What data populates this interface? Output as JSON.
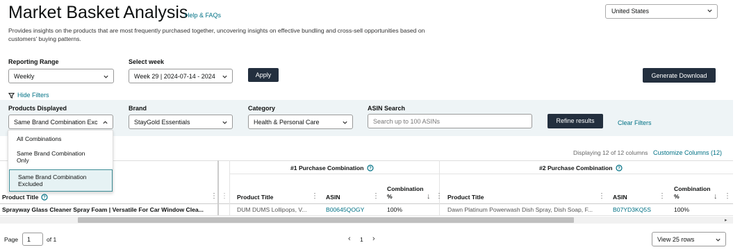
{
  "header": {
    "title": "Market Basket Analysis",
    "help_link": "Help & FAQs",
    "description": "Provides insights on the products that are most frequently purchased together, uncovering insights on effective bundling and cross-sell opportunities based on customers' buying patterns.",
    "country": "United States"
  },
  "controls": {
    "reporting_range_label": "Reporting Range",
    "reporting_range_value": "Weekly",
    "select_week_label": "Select week",
    "select_week_value": "Week 29 | 2024-07-14 - 2024",
    "apply_label": "Apply",
    "generate_download_label": "Generate Download",
    "hide_filters_label": "Hide Filters"
  },
  "filters": {
    "products_displayed_label": "Products Displayed",
    "products_displayed_value": "Same Brand Combination Exc",
    "brand_label": "Brand",
    "brand_value": "StayGold Essentials",
    "category_label": "Category",
    "category_value": "Health & Personal Care",
    "asin_search_label": "ASIN Search",
    "asin_search_placeholder": "Search up to 100 ASINs",
    "refine_label": "Refine results",
    "clear_label": "Clear Filters"
  },
  "dropdown": {
    "options": [
      "All Combinations",
      "Same Brand Combination Only",
      "Same Brand Combination Excluded"
    ],
    "selected_index": 2
  },
  "table": {
    "displaying": "Displaying 12 of 12 columns",
    "customize": "Customize Columns (12)",
    "group1": "#1 Purchase Combination",
    "group2": "#2 Purchase Combination",
    "col_product_title": "Product Title",
    "col_asin": "ASIN",
    "col_combination": "Combination %",
    "row": {
      "product": "Sprayway Glass Cleaner Spray Foam | Versatile For Car Window Clea...",
      "p1_title": "DUM DUMS Lollipops, V...",
      "p1_asin": "B00645QOGY",
      "p1_pct": "100%",
      "p2_title": "Dawn Platinum Powerwash Dish Spray, Dish Soap, F...",
      "p2_asin": "B07YD3KQ5S",
      "p2_pct": "100%"
    }
  },
  "pagination": {
    "page_label": "Page",
    "page_value": "1",
    "of_label": "of 1",
    "current": "1",
    "rows_label": "View 25 rows"
  }
}
